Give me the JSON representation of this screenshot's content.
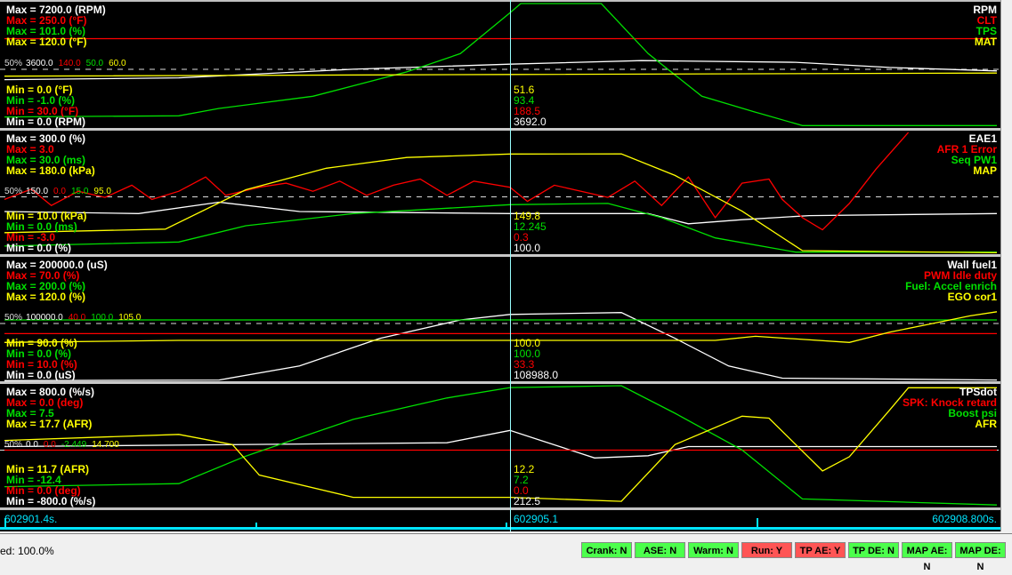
{
  "time_axis": {
    "start_label": "602901.4s.",
    "cursor_label": "602905.1",
    "end_label": "602908.800s.",
    "start": 0,
    "end": 7.4,
    "cursor": 3.77
  },
  "panels": [
    {
      "mid_label": "50%",
      "traces": [
        {
          "name": "RPM",
          "color": "#ffffff",
          "max_label": "Max = 7200.0 (RPM)",
          "min_label": "Min = 0.0 (RPM)",
          "mid": "3600.0",
          "cursor_value": "3692.0",
          "min": 0,
          "max": 7200,
          "points": [
            [
              0,
              2800
            ],
            [
              1.3,
              2900
            ],
            [
              2.6,
              3400
            ],
            [
              3.77,
              3692
            ],
            [
              4.75,
              3900
            ],
            [
              5.9,
              3800
            ],
            [
              6.6,
              3500
            ],
            [
              7.4,
              3300
            ]
          ]
        },
        {
          "name": "CLT",
          "color": "#ff0000",
          "max_label": "Max = 250.0 (°F)",
          "min_label": "Min = 30.0 (°F)",
          "mid": "140.0",
          "cursor_value": "188.5",
          "min": 30,
          "max": 250,
          "points": [
            [
              0,
              188
            ],
            [
              7.4,
              188
            ]
          ]
        },
        {
          "name": "TPS",
          "color": "#00e000",
          "max_label": "Max = 101.0 (%)",
          "min_label": "Min = -1.0 (%)",
          "mid": "50.0",
          "cursor_value": "93.4",
          "min": -1,
          "max": 101,
          "points": [
            [
              0,
              8
            ],
            [
              1.3,
              9
            ],
            [
              1.6,
              15
            ],
            [
              2.3,
              25
            ],
            [
              3.0,
              45
            ],
            [
              3.4,
              60
            ],
            [
              3.77,
              93.4
            ],
            [
              3.85,
              101
            ],
            [
              4.45,
              101
            ],
            [
              4.8,
              60
            ],
            [
              5.2,
              25
            ],
            [
              5.6,
              12
            ],
            [
              5.95,
              1
            ],
            [
              7.4,
              1
            ]
          ]
        },
        {
          "name": "MAT",
          "color": "#ffff00",
          "max_label": "Max = 120.0 (°F)",
          "min_label": "Min = 0.0 (°F)",
          "mid": "60.0",
          "cursor_value": "51.6",
          "min": 0,
          "max": 120,
          "points": [
            [
              0,
              50
            ],
            [
              3.77,
              51.6
            ],
            [
              7.4,
              53
            ]
          ]
        }
      ]
    },
    {
      "mid_label": "50%",
      "traces": [
        {
          "name": "EAE1",
          "color": "#ffffff",
          "max_label": "Max = 300.0 (%)",
          "min_label": "Min = 0.0 (%)",
          "mid": "150.0",
          "cursor_value": "100.0",
          "min": 0,
          "max": 300,
          "points": [
            [
              0,
              105
            ],
            [
              1.0,
              100
            ],
            [
              1.6,
              128
            ],
            [
              2.2,
              105
            ],
            [
              3.77,
              100
            ],
            [
              4.8,
              100
            ],
            [
              5.1,
              75
            ],
            [
              5.5,
              85
            ],
            [
              6.0,
              95
            ],
            [
              7.4,
              100
            ]
          ]
        },
        {
          "name": "AFR 1 Error",
          "color": "#ff0000",
          "max_label": "Max = 3.0",
          "min_label": "Min = -3.0",
          "mid": "0.0",
          "cursor_value": "0.3",
          "min": -3,
          "max": 3,
          "points": [
            [
              0,
              -0.3
            ],
            [
              0.2,
              0.2
            ],
            [
              0.35,
              -0.6
            ],
            [
              0.55,
              0.1
            ],
            [
              0.75,
              -0.2
            ],
            [
              0.95,
              0.4
            ],
            [
              1.1,
              -0.3
            ],
            [
              1.3,
              0.1
            ],
            [
              1.5,
              0.8
            ],
            [
              1.65,
              -0.1
            ],
            [
              1.9,
              0.3
            ],
            [
              2.1,
              0.5
            ],
            [
              2.3,
              0.1
            ],
            [
              2.5,
              0.6
            ],
            [
              2.7,
              -0.1
            ],
            [
              2.9,
              0.4
            ],
            [
              3.1,
              0.7
            ],
            [
              3.3,
              -0.1
            ],
            [
              3.5,
              0.6
            ],
            [
              3.77,
              0.3
            ],
            [
              3.9,
              -0.4
            ],
            [
              4.1,
              0.4
            ],
            [
              4.3,
              0.1
            ],
            [
              4.5,
              -0.2
            ],
            [
              4.7,
              0.6
            ],
            [
              4.9,
              -0.6
            ],
            [
              5.1,
              0.8
            ],
            [
              5.3,
              -1.2
            ],
            [
              5.5,
              0.5
            ],
            [
              5.7,
              0.7
            ],
            [
              5.8,
              -0.3
            ],
            [
              5.95,
              -1.2
            ],
            [
              6.1,
              -1.8
            ],
            [
              6.3,
              -0.5
            ],
            [
              6.5,
              1.2
            ],
            [
              6.74,
              3
            ]
          ]
        },
        {
          "name": "Seq PW1",
          "color": "#00e000",
          "max_label": "Max = 30.0 (ms)",
          "min_label": "Min = 0.0 (ms)",
          "mid": "15.0",
          "cursor_value": "12.245",
          "min": 0,
          "max": 30,
          "points": [
            [
              0,
              2
            ],
            [
              1.3,
              3
            ],
            [
              1.8,
              7
            ],
            [
              2.6,
              10
            ],
            [
              3.77,
              12.2
            ],
            [
              4.5,
              12.5
            ],
            [
              4.9,
              9
            ],
            [
              5.3,
              4
            ],
            [
              5.9,
              0.5
            ],
            [
              7.4,
              0.5
            ]
          ]
        },
        {
          "name": "MAP",
          "color": "#ffff00",
          "max_label": "Max = 180.0 (kPa)",
          "min_label": "Min = 10.0 (kPa)",
          "mid": "95.0",
          "cursor_value": "149.8",
          "min": 10,
          "max": 180,
          "points": [
            [
              0,
              40
            ],
            [
              1.2,
              45
            ],
            [
              1.8,
              100
            ],
            [
              2.4,
              130
            ],
            [
              3.0,
              145
            ],
            [
              3.77,
              149.8
            ],
            [
              4.6,
              150
            ],
            [
              5.0,
              120
            ],
            [
              5.5,
              70
            ],
            [
              5.95,
              15
            ],
            [
              7.4,
              12
            ]
          ]
        }
      ]
    },
    {
      "mid_label": "50%",
      "traces": [
        {
          "name": "Wall fuel1",
          "color": "#ffffff",
          "max_label": "Max = 200000.0 (uS)",
          "min_label": "Min = 0.0 (uS)",
          "mid": "100000.0",
          "cursor_value": "108988.0",
          "min": 0,
          "max": 200000,
          "points": [
            [
              0,
              1000
            ],
            [
              1.6,
              2000
            ],
            [
              2.2,
              25000
            ],
            [
              2.8,
              70000
            ],
            [
              3.4,
              100000
            ],
            [
              3.77,
              108988
            ],
            [
              4.6,
              112000
            ],
            [
              5.0,
              70000
            ],
            [
              5.4,
              25000
            ],
            [
              5.8,
              5000
            ],
            [
              7.4,
              2000
            ]
          ]
        },
        {
          "name": "PWM Idle duty",
          "color": "#ff0000",
          "max_label": "Max = 70.0 (%)",
          "min_label": "Min = 10.0 (%)",
          "mid": "40.0",
          "cursor_value": "33.3",
          "min": 10,
          "max": 70,
          "points": [
            [
              0,
              33.3
            ],
            [
              7.4,
              33.3
            ]
          ]
        },
        {
          "name": "Fuel: Accel enrich",
          "color": "#00e000",
          "max_label": "Max = 200.0 (%)",
          "min_label": "Min = 0.0 (%)",
          "mid": "100.0",
          "cursor_value": "100.0",
          "min": 0,
          "max": 200,
          "points": [
            [
              0,
              100
            ],
            [
              7.4,
              100
            ]
          ]
        },
        {
          "name": "EGO cor1",
          "color": "#ffff00",
          "max_label": "Max = 120.0 (%)",
          "min_label": "Min = 90.0 (%)",
          "mid": "105.0",
          "cursor_value": "100.0",
          "min": 90,
          "max": 120,
          "points": [
            [
              0,
              99.5
            ],
            [
              1.3,
              100
            ],
            [
              3.77,
              100
            ],
            [
              5.3,
              100
            ],
            [
              5.6,
              101
            ],
            [
              6.3,
              99.5
            ],
            [
              6.6,
              102
            ],
            [
              6.9,
              104
            ],
            [
              7.2,
              106
            ],
            [
              7.4,
              107
            ]
          ]
        }
      ]
    },
    {
      "mid_label": "50%",
      "traces": [
        {
          "name": "TPSdot",
          "color": "#ffffff",
          "max_label": "Max = 800.0 (%/s)",
          "min_label": "Min = -800.0 (%/s)",
          "mid": "0.0",
          "cursor_value": "212.5",
          "min": -800,
          "max": 800,
          "points": [
            [
              0,
              0
            ],
            [
              3.3,
              50
            ],
            [
              3.77,
              212
            ],
            [
              4.0,
              80
            ],
            [
              4.4,
              -150
            ],
            [
              4.8,
              -120
            ],
            [
              5.1,
              0
            ],
            [
              7.4,
              0
            ]
          ]
        },
        {
          "name": "SPK: Knock retard",
          "color": "#ff0000",
          "max_label": "Max = 0.0 (deg)",
          "min_label": "Min = 0.0 (deg)",
          "mid": "0.0",
          "cursor_value": "0.0",
          "min": 0,
          "max": 0,
          "points": [
            [
              0,
              0
            ],
            [
              7.4,
              0
            ]
          ]
        },
        {
          "name": "Boost psi",
          "color": "#00e000",
          "max_label": "Max = 7.5",
          "min_label": "Min = -12.4",
          "mid": "-2.449",
          "cursor_value": "7.2",
          "min": -12.4,
          "max": 7.5,
          "points": [
            [
              0,
              -9
            ],
            [
              1.3,
              -8.5
            ],
            [
              1.8,
              -4
            ],
            [
              2.6,
              2
            ],
            [
              3.3,
              5.5
            ],
            [
              3.77,
              7.2
            ],
            [
              4.6,
              7.5
            ],
            [
              5.0,
              3
            ],
            [
              5.5,
              -3
            ],
            [
              5.95,
              -11
            ],
            [
              7.4,
              -12
            ]
          ]
        },
        {
          "name": "AFR",
          "color": "#ffff00",
          "max_label": "Max = 17.7 (AFR)",
          "min_label": "Min = 11.7 (AFR)",
          "mid": "14.700",
          "cursor_value": "12.2",
          "min": 11.7,
          "max": 17.7,
          "points": [
            [
              0,
              15.0
            ],
            [
              1.3,
              15.3
            ],
            [
              1.7,
              14.8
            ],
            [
              1.9,
              13.3
            ],
            [
              2.6,
              12.2
            ],
            [
              3.77,
              12.2
            ],
            [
              4.6,
              12.0
            ],
            [
              5.0,
              14.8
            ],
            [
              5.5,
              16.2
            ],
            [
              5.7,
              16.1
            ],
            [
              6.1,
              13.5
            ],
            [
              6.3,
              14.2
            ],
            [
              6.6,
              16.5
            ],
            [
              6.74,
              17.6
            ],
            [
              7.4,
              17.6
            ]
          ]
        }
      ]
    }
  ],
  "status": {
    "speed_label": "ed: 100.0%",
    "flags": [
      {
        "label": "Crank: N",
        "color": "#4cff4c"
      },
      {
        "label": "ASE: N",
        "color": "#4cff4c"
      },
      {
        "label": "Warm: N",
        "color": "#4cff4c"
      },
      {
        "label": "Run: Y",
        "color": "#ff5555"
      },
      {
        "label": "TP AE: Y",
        "color": "#ff5555"
      },
      {
        "label": "TP DE: N",
        "color": "#4cff4c"
      },
      {
        "label": "MAP AE: N",
        "color": "#4cff4c"
      },
      {
        "label": "MAP DE: N",
        "color": "#4cff4c"
      }
    ]
  }
}
